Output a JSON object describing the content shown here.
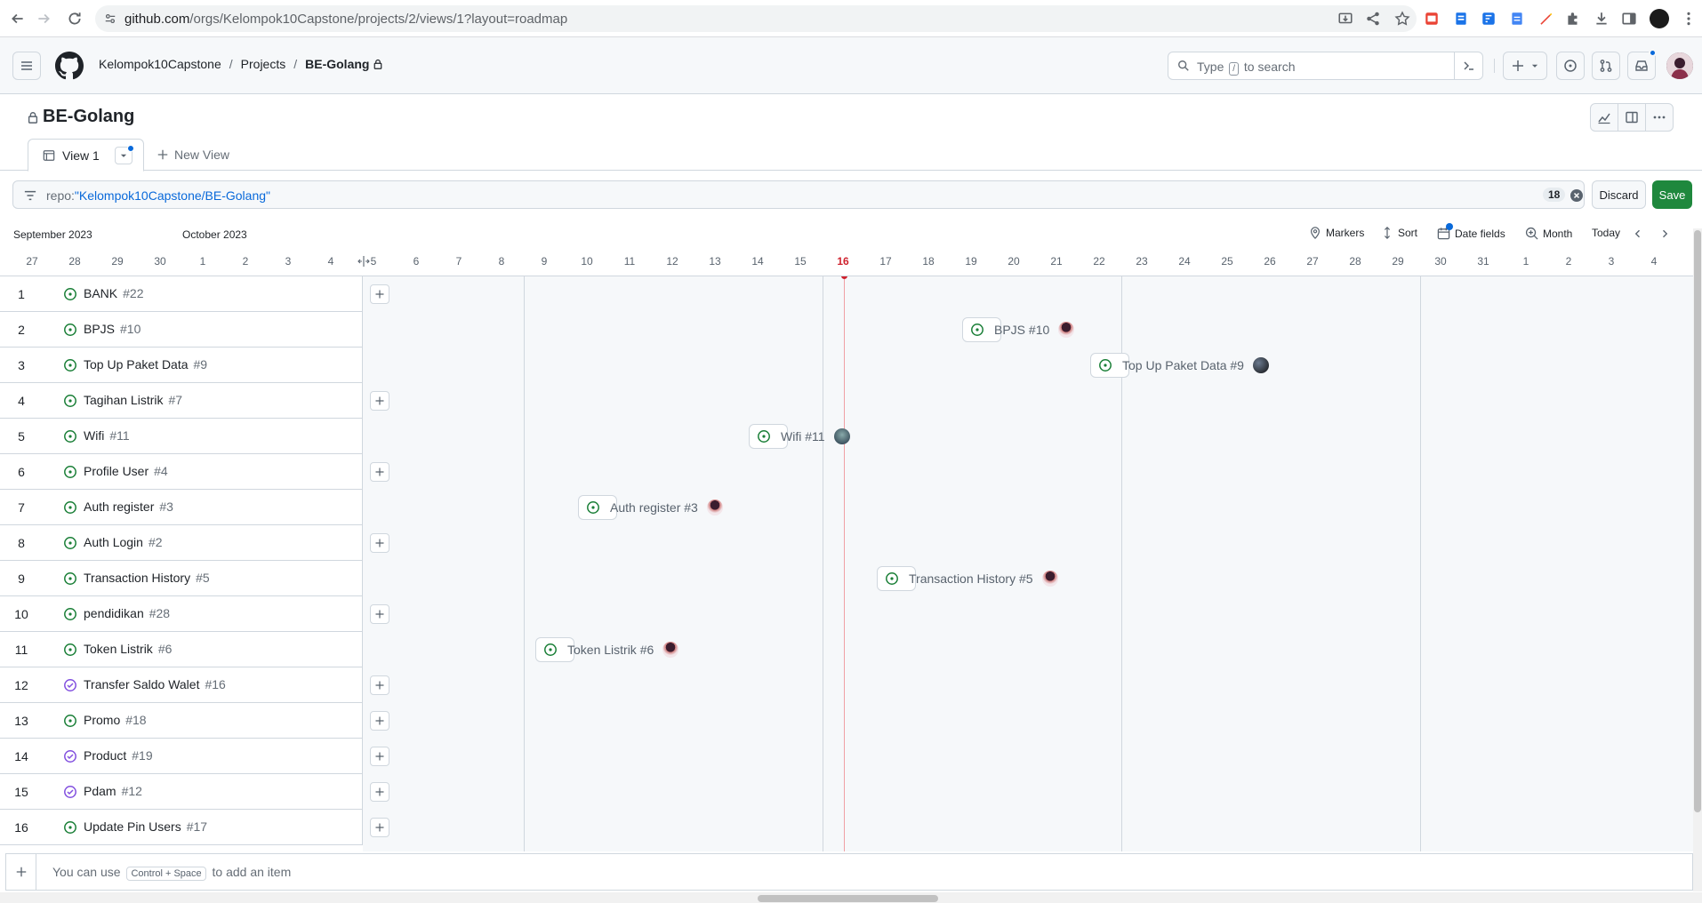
{
  "browser": {
    "url_host": "github.com",
    "url_path": "/orgs/Kelompok10Capstone/projects/2/views/1?layout=roadmap"
  },
  "header": {
    "breadcrumbs": [
      "Kelompok10Capstone",
      "Projects",
      "BE-Golang"
    ],
    "search_prefix": "Type",
    "search_key": "/",
    "search_suffix": "to search"
  },
  "project": {
    "title": "BE-Golang",
    "tabs": [
      {
        "label": "View 1"
      }
    ],
    "new_view_label": "New View"
  },
  "filter": {
    "key": "repo:",
    "value": "\"Kelompok10Capstone/BE-Golang\"",
    "count": "18",
    "discard_label": "Discard",
    "save_label": "Save"
  },
  "roadmap": {
    "months": [
      "September 2023",
      "October 2023"
    ],
    "tools": {
      "markers": "Markers",
      "sort": "Sort",
      "date_fields": "Date fields",
      "zoom": "Month",
      "today": "Today"
    },
    "days": [
      "27",
      "28",
      "29",
      "30",
      "1",
      "2",
      "3",
      "4",
      "5",
      "6",
      "7",
      "8",
      "9",
      "10",
      "11",
      "12",
      "13",
      "14",
      "15",
      "16",
      "17",
      "18",
      "19",
      "20",
      "21",
      "22",
      "23",
      "24",
      "25",
      "26",
      "27",
      "28",
      "29",
      "30",
      "31",
      "1",
      "2",
      "3",
      "4"
    ],
    "today_day": "16"
  },
  "items": [
    {
      "num": "1",
      "title": "BANK",
      "issue": "#22",
      "state": "open"
    },
    {
      "num": "2",
      "title": "BPJS",
      "issue": "#10",
      "state": "open"
    },
    {
      "num": "3",
      "title": "Top Up Paket Data",
      "issue": "#9",
      "state": "open"
    },
    {
      "num": "4",
      "title": "Tagihan Listrik",
      "issue": "#7",
      "state": "open"
    },
    {
      "num": "5",
      "title": "Wifi",
      "issue": "#11",
      "state": "open"
    },
    {
      "num": "6",
      "title": "Profile User",
      "issue": "#4",
      "state": "open"
    },
    {
      "num": "7",
      "title": "Auth register",
      "issue": "#3",
      "state": "open"
    },
    {
      "num": "8",
      "title": "Auth Login",
      "issue": "#2",
      "state": "open"
    },
    {
      "num": "9",
      "title": "Transaction History",
      "issue": "#5",
      "state": "open"
    },
    {
      "num": "10",
      "title": "pendidikan",
      "issue": "#28",
      "state": "open"
    },
    {
      "num": "11",
      "title": "Token Listrik",
      "issue": "#6",
      "state": "open"
    },
    {
      "num": "12",
      "title": "Transfer Saldo Walet",
      "issue": "#16",
      "state": "closed"
    },
    {
      "num": "13",
      "title": "Promo",
      "issue": "#18",
      "state": "open"
    },
    {
      "num": "14",
      "title": "Product",
      "issue": "#19",
      "state": "closed"
    },
    {
      "num": "15",
      "title": "Pdam",
      "issue": "#12",
      "state": "closed"
    },
    {
      "num": "16",
      "title": "Update Pin Users",
      "issue": "#17",
      "state": "open"
    }
  ],
  "bars": [
    {
      "label": "BPJS #10",
      "row": 2,
      "date": "Oct 19"
    },
    {
      "label": "Top Up Paket Data #9",
      "row": 3,
      "date": "Oct 22"
    },
    {
      "label": "Wifi #11",
      "row": 5,
      "date": "Oct 14"
    },
    {
      "label": "Auth register #3",
      "row": 7,
      "date": "Oct 10"
    },
    {
      "label": "Transaction History #5",
      "row": 9,
      "date": "Oct 17"
    },
    {
      "label": "Token Listrik #6",
      "row": 11,
      "date": "Oct 9"
    }
  ],
  "footer": {
    "prefix": "You can use",
    "shortcut": "Control + Space",
    "suffix": "to add an item"
  },
  "colors": {
    "open": "#1a7f37",
    "closed": "#8250df",
    "save": "#1f883d",
    "today": "#cf222e",
    "link": "#0969da"
  }
}
